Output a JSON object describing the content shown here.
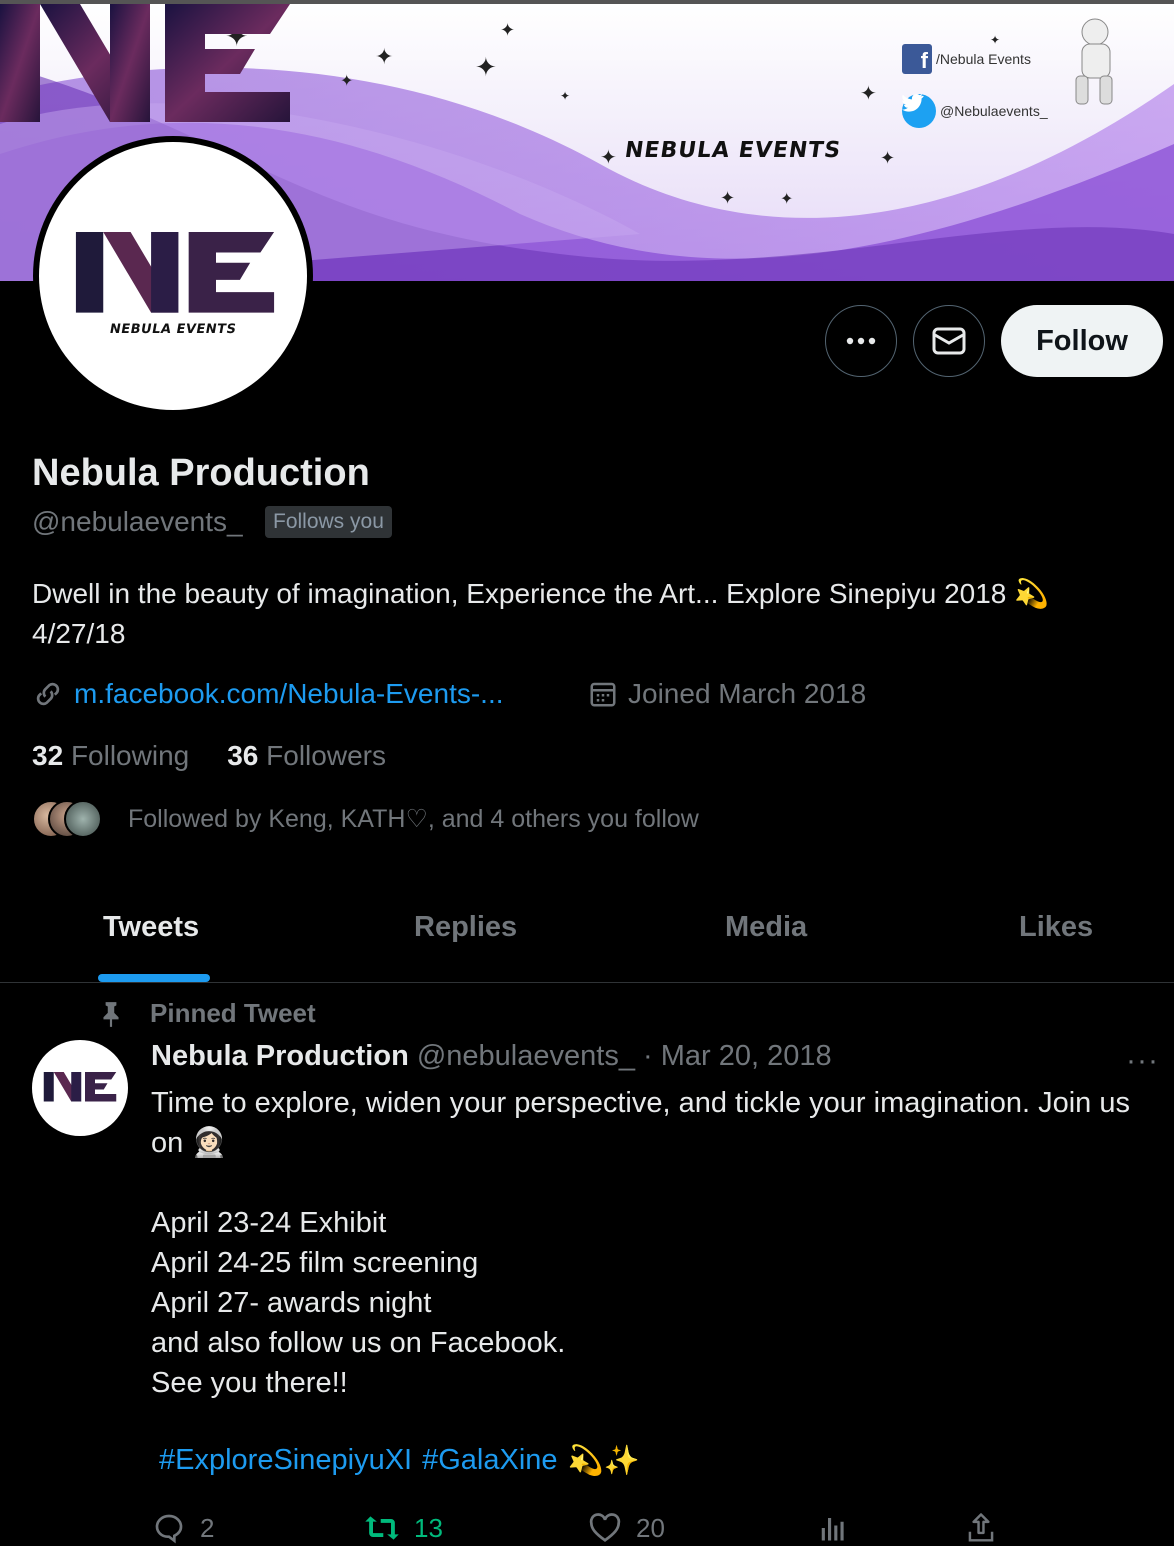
{
  "banner": {
    "title": "NEBULA EVENTS",
    "facebook": "/Nebula Events",
    "twitter": "@Nebulaevents_"
  },
  "avatar": {
    "caption": "NEBULA EVENTS"
  },
  "actions": {
    "follow_label": "Follow"
  },
  "profile": {
    "name": "Nebula Production",
    "handle": "@nebulaevents_",
    "follows_you": "Follows you",
    "bio_line1": "Dwell in the beauty of imagination, Experience the Art... Explore Sinepiyu 2018 💫",
    "bio_line2": "4/27/18",
    "link": "m.facebook.com/Nebula-Events-...",
    "joined": "Joined March 2018",
    "following_count": "32",
    "following_label": "Following",
    "followers_count": "36",
    "followers_label": "Followers",
    "followed_by": "Followed by Keng, KATH♡, and 4 others you follow"
  },
  "tabs": [
    "Tweets",
    "Replies",
    "Media",
    "Likes"
  ],
  "tweet": {
    "pinned_label": "Pinned Tweet",
    "author": "Nebula Production",
    "handle": "@nebulaevents_",
    "date": "· Mar 20, 2018",
    "more": "···",
    "body": "Time to explore, widen your perspective, and tickle your imagination. Join us on 👩🏻‍🚀\n\nApril 23-24 Exhibit\nApril 24-25 film screening\nApril 27- awards night\nand also follow us on Facebook.\nSee you there!!",
    "hashtag1": "#ExploreSinepiyuXI",
    "hashtag2": "#GalaXine",
    "hashtag_emoji": "💫✨",
    "replies": "2",
    "retweets": "13",
    "likes": "20"
  },
  "icons": [
    "more-icon",
    "message-icon",
    "link-icon",
    "calendar-icon",
    "pin-icon",
    "reply-icon",
    "retweet-icon",
    "like-icon",
    "views-icon",
    "share-icon"
  ],
  "colors": {
    "accent": "#1d9bf0",
    "retweet": "#00ba7c",
    "banner_purple": "#8a4fd6"
  }
}
